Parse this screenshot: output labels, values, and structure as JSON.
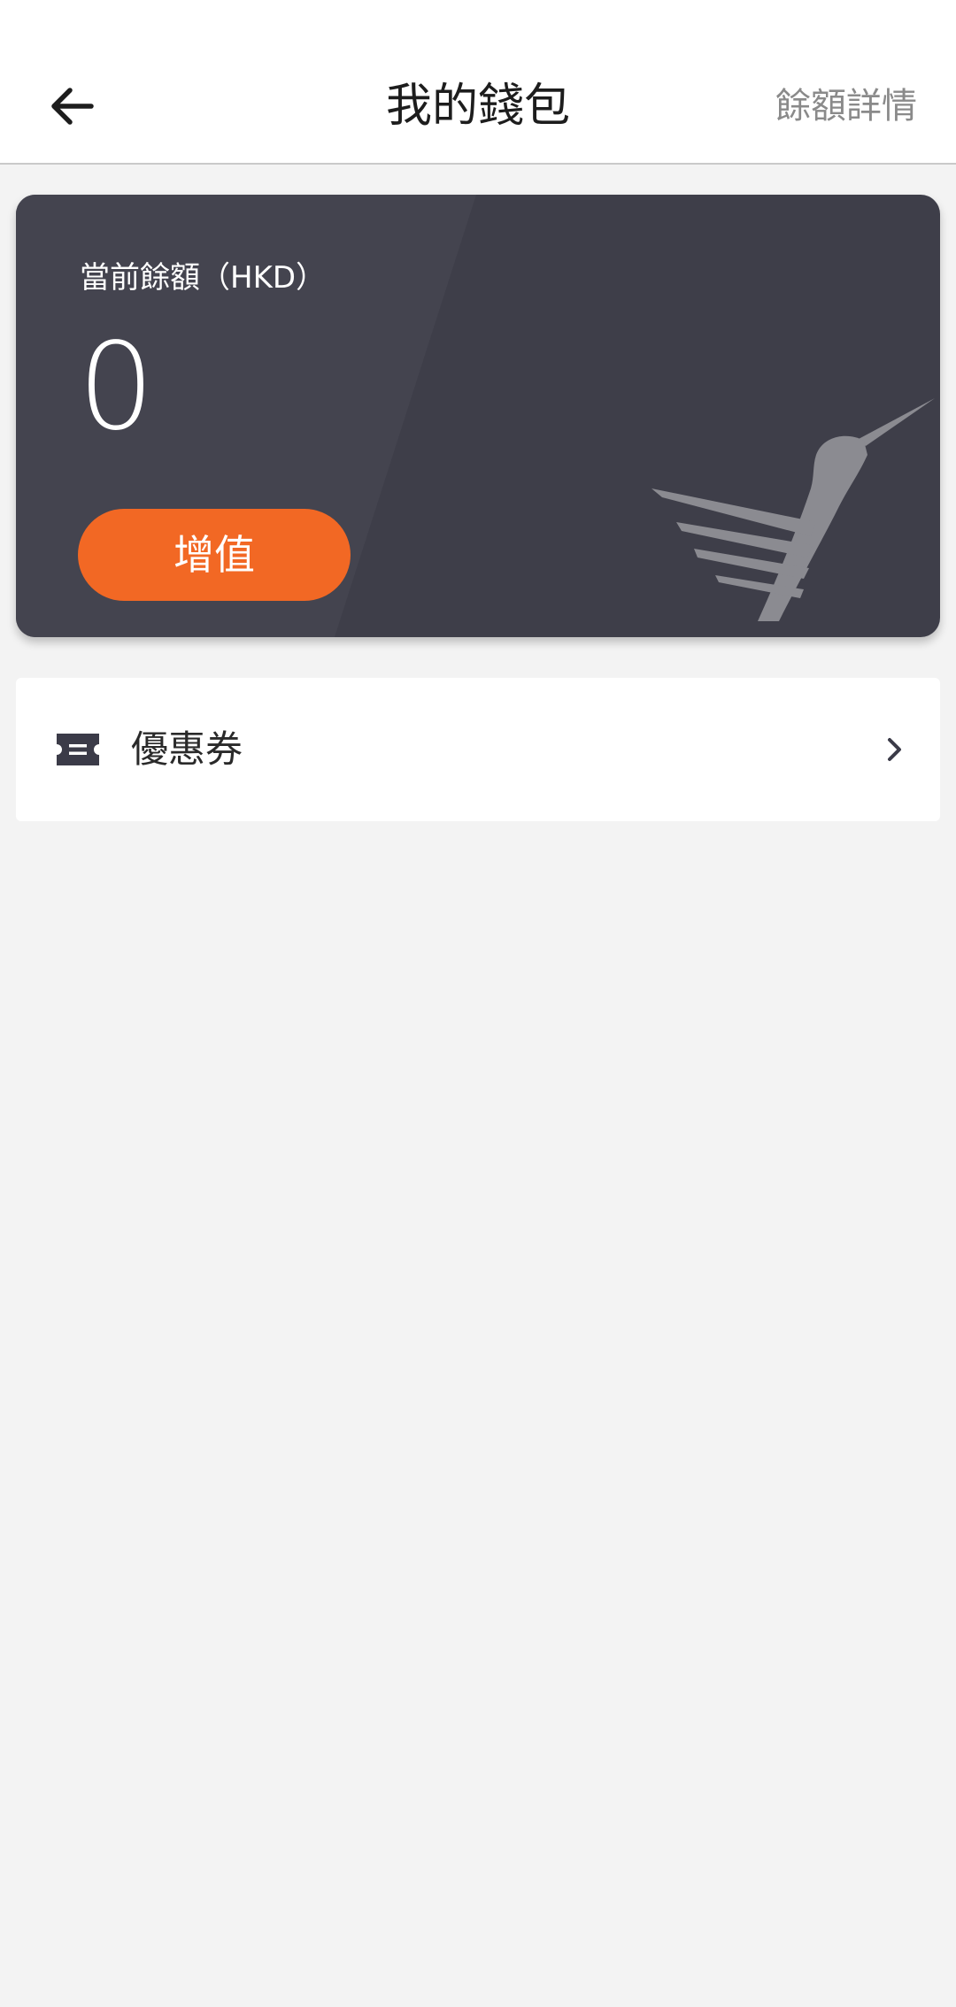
{
  "header": {
    "title": "我的錢包",
    "balance_details_link": "餘額詳情",
    "back_icon": "back-arrow-icon"
  },
  "wallet": {
    "balance_label": "當前餘額（HKD）",
    "balance_value": "0",
    "topup_label": "增值",
    "card_color": "#3e3e49",
    "accent_color": "#f26824",
    "logo_icon": "hummingbird-logo"
  },
  "menu": {
    "coupon_label": "優惠券",
    "coupon_icon": "ticket-icon",
    "chevron_icon": "chevron-right-icon"
  }
}
